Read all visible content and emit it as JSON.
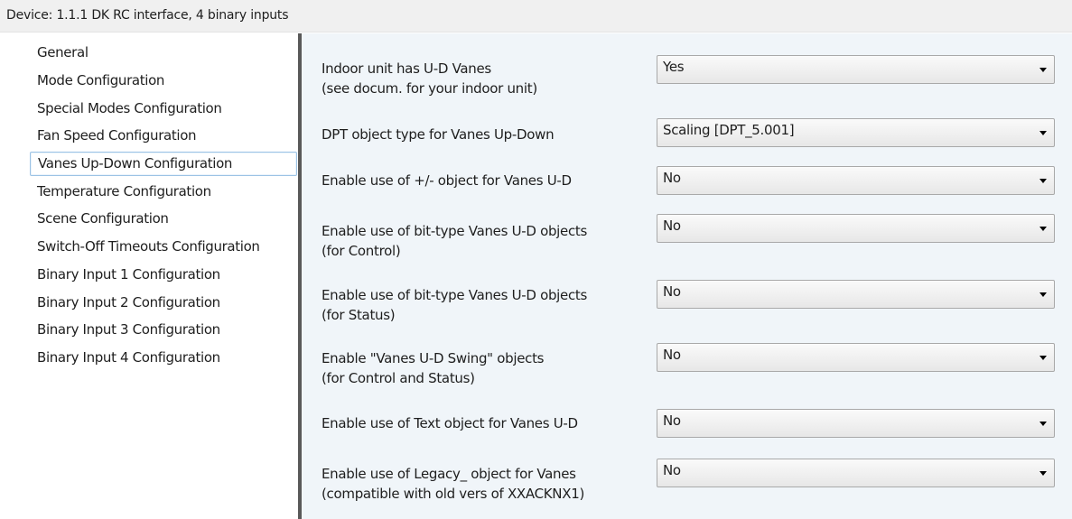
{
  "window": {
    "title": "Device: 1.1.1  DK RC interface, 4 binary inputs"
  },
  "colors": {
    "panel_background": "#f0f5f9",
    "selection_border": "#9cc3e5",
    "splitter": "#595959"
  },
  "sidebar": {
    "selected_index": 4,
    "items": [
      {
        "label": "General"
      },
      {
        "label": "Mode Configuration"
      },
      {
        "label": "Special Modes Configuration"
      },
      {
        "label": "Fan Speed Configuration"
      },
      {
        "label": "Vanes Up-Down Configuration"
      },
      {
        "label": "Temperature Configuration"
      },
      {
        "label": "Scene Configuration"
      },
      {
        "label": "Switch-Off Timeouts Configuration"
      },
      {
        "label": "Binary Input 1 Configuration"
      },
      {
        "label": "Binary Input 2 Configuration"
      },
      {
        "label": "Binary Input 3 Configuration"
      },
      {
        "label": "Binary Input 4 Configuration"
      }
    ]
  },
  "parameters": [
    {
      "line1": "Indoor unit has U-D Vanes",
      "line2": "(see docum. for your indoor unit)",
      "value": "Yes",
      "icon": "chevron-down-icon"
    },
    {
      "line1": "DPT object type for Vanes Up-Down",
      "line2": "",
      "value": "Scaling [DPT_5.001]",
      "icon": "chevron-down-icon"
    },
    {
      "line1": "Enable use of +/- object for Vanes U-D",
      "line2": "",
      "value": "No",
      "icon": "chevron-down-icon"
    },
    {
      "line1": "Enable use of bit-type Vanes U-D objects",
      "line2": "(for Control)",
      "value": "No",
      "icon": "chevron-down-icon"
    },
    {
      "line1": "Enable use of bit-type Vanes U-D objects",
      "line2": "(for Status)",
      "value": "No",
      "icon": "chevron-down-icon"
    },
    {
      "line1": "Enable \"Vanes U-D Swing\" objects",
      "line2": "(for Control and Status)",
      "value": "No",
      "icon": "chevron-down-icon"
    },
    {
      "line1": "Enable use of Text object for Vanes U-D",
      "line2": "",
      "value": "No",
      "icon": "chevron-down-icon"
    },
    {
      "line1": "Enable use of Legacy_ object for Vanes",
      "line2": "(compatible with old vers of XXACKNX1)",
      "value": "No",
      "icon": "chevron-down-icon"
    }
  ]
}
